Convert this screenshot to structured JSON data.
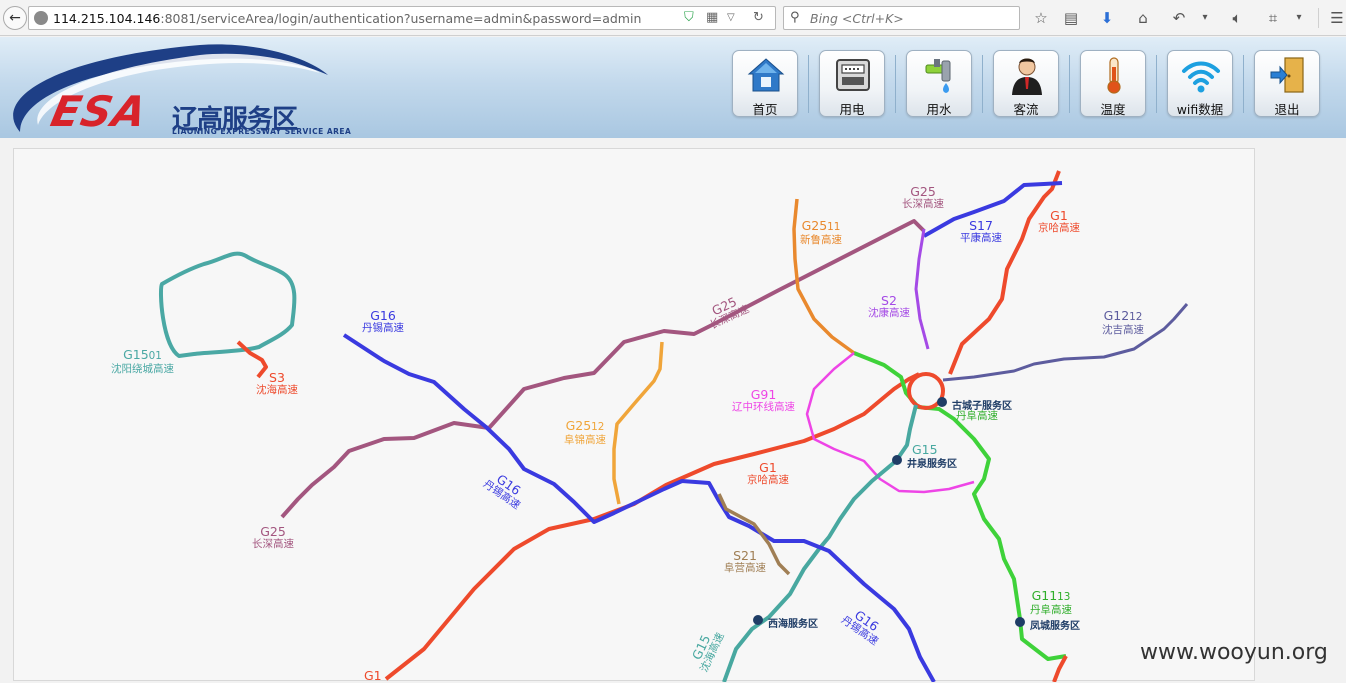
{
  "browser": {
    "url_host": "114.215.104.146",
    "url_rest": ":8081/serviceArea/login/authentication?username=admin&password=admin",
    "search_placeholder": "Bing <Ctrl+K>"
  },
  "header": {
    "logo_text": "ESA",
    "logo_cn": "辽高服务区",
    "logo_en": "LIAONING EXPRESSWAY SERVICE AREA",
    "nav": [
      {
        "label": "首页",
        "icon": "home-icon"
      },
      {
        "label": "用电",
        "icon": "electric-meter-icon"
      },
      {
        "label": "用水",
        "icon": "water-tap-icon"
      },
      {
        "label": "客流",
        "icon": "person-icon"
      },
      {
        "label": "温度",
        "icon": "thermometer-icon"
      },
      {
        "label": "wifi数据",
        "icon": "wifi-icon"
      },
      {
        "label": "退出",
        "icon": "exit-door-icon"
      }
    ]
  },
  "map": {
    "colors": {
      "g25": "#a3567f",
      "g1": "#ee4a2c",
      "g16": "#3a3ae0",
      "g15": "#48a8a0",
      "g1501": "#4aa8a4",
      "s3": "#ee4a2c",
      "g2511": "#e9892e",
      "g2512": "#f0a53a",
      "s2": "#a54ae6",
      "s17": "#3a3ae0",
      "g1212": "#5d5c9e",
      "g91": "#ee45e6",
      "g1113": "#3fd23a",
      "s21": "#a07f55",
      "sa": "#1f3d66"
    },
    "roads": {
      "g25_top": {
        "code": "G25",
        "name": "长深高速"
      },
      "g2511": {
        "code": "G25",
        "sub": "11",
        "name": "新鲁高速"
      },
      "s17": {
        "code": "S17",
        "name": "平康高速"
      },
      "g1_top": {
        "code": "G1",
        "name": "京哈高速"
      },
      "s2": {
        "code": "S2",
        "name": "沈康高速"
      },
      "g1212": {
        "code": "G12",
        "sub": "12",
        "name": "沈吉高速"
      },
      "g25_mid": {
        "code": "G25",
        "name": "长深高速"
      },
      "g16_top": {
        "code": "G16",
        "name": "丹锡高速"
      },
      "g1501": {
        "code": "G15",
        "sub": "01",
        "name": "沈阳绕城高速"
      },
      "s3": {
        "code": "S3",
        "name": "沈海高速"
      },
      "g91": {
        "code": "G91",
        "name": "辽中环线高速"
      },
      "g2512": {
        "code": "G25",
        "sub": "12",
        "name": "阜锦高速"
      },
      "g15_mid": {
        "code": "G15",
        "name": "沈海高速"
      },
      "g1_mid": {
        "code": "G1",
        "name": "京哈高速"
      },
      "g16_mid": {
        "code": "G16",
        "name": "丹锡高速"
      },
      "g25_low": {
        "code": "G25",
        "name": "长深高速"
      },
      "s21": {
        "code": "S21",
        "name": "阜营高速"
      },
      "g1113": {
        "code": "G11",
        "sub": "13",
        "name": "丹阜高速"
      },
      "g1113_top": {
        "name": "丹阜高速"
      },
      "g16_low": {
        "code": "G16",
        "name": "丹锡高速"
      },
      "g15_low": {
        "code": "G15",
        "name": "沈海高速"
      },
      "g1_low": {
        "code": "G1"
      }
    },
    "service_areas": [
      "古城子服务区",
      "井泉服务区",
      "西海服务区",
      "凤城服务区"
    ]
  },
  "watermark": "www.wooyun.org"
}
